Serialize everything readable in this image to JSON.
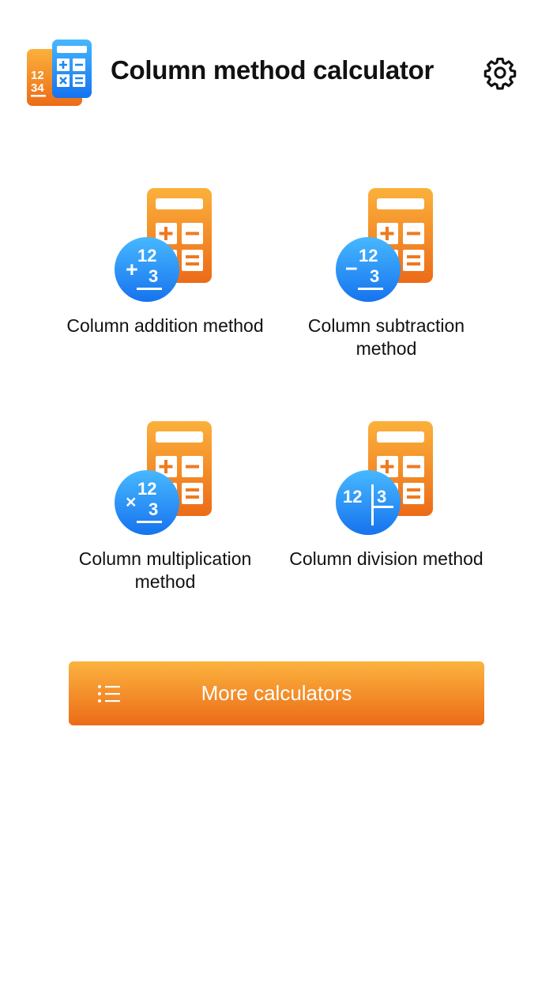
{
  "header": {
    "title": "Column method calculator",
    "logo_icon": "calculator-logo-icon",
    "logo_digits": [
      "12",
      "34"
    ],
    "settings_icon": "gear-icon"
  },
  "operations": [
    {
      "label": "Column addition method",
      "icon": "column-addition-icon",
      "badge_sign": "+",
      "badge_top": "12",
      "badge_bottom": "3"
    },
    {
      "label": "Column subtraction method",
      "icon": "column-subtraction-icon",
      "badge_sign": "−",
      "badge_top": "12",
      "badge_bottom": "3"
    },
    {
      "label": "Column multiplication method",
      "icon": "column-multiplication-icon",
      "badge_sign": "×",
      "badge_top": "12",
      "badge_bottom": "3"
    },
    {
      "label": "Column division method",
      "icon": "column-division-icon",
      "badge_left": "12",
      "badge_right": "3"
    }
  ],
  "more_button": {
    "label": "More calculators",
    "icon": "list-icon"
  },
  "colors": {
    "orange_light": "#fbb43f",
    "orange_dark": "#ec6b18",
    "blue_light": "#45b5ff",
    "blue_dark": "#1677f0",
    "text": "#111111",
    "background": "#ffffff"
  }
}
